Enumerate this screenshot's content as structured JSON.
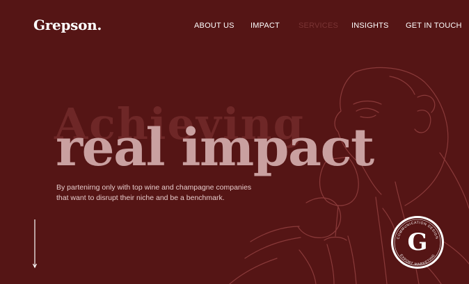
{
  "header": {
    "logo": "Grepson."
  },
  "nav": {
    "items": [
      {
        "label": "ABOUT US",
        "active": false
      },
      {
        "label": "IMPACT",
        "active": false
      },
      {
        "label": "SERVICES",
        "active": true
      },
      {
        "label": "INSIGHTS",
        "active": false
      },
      {
        "label": "GET IN TOUCH",
        "active": false
      }
    ]
  },
  "hero": {
    "ghost_word": "Achieving",
    "headline": "real impact",
    "subtitle": "By partenirng only with top wine and champagne companies that want to disrupt their niche and be a benchmark."
  },
  "badge": {
    "letter": "G",
    "ring_top": "COMMUNICATION DESIGN",
    "ring_bottom": "EXPORT MARKETING"
  },
  "icons": {
    "scroll_arrow": "arrow-down-icon",
    "illustration": "line-art-portrait-illustration"
  },
  "colors": {
    "background": "#551515",
    "headline": "#c9a0a0",
    "ghost_text": "#6e2727",
    "line_art": "#8a3a3a",
    "nav_active": "#7a3434"
  }
}
